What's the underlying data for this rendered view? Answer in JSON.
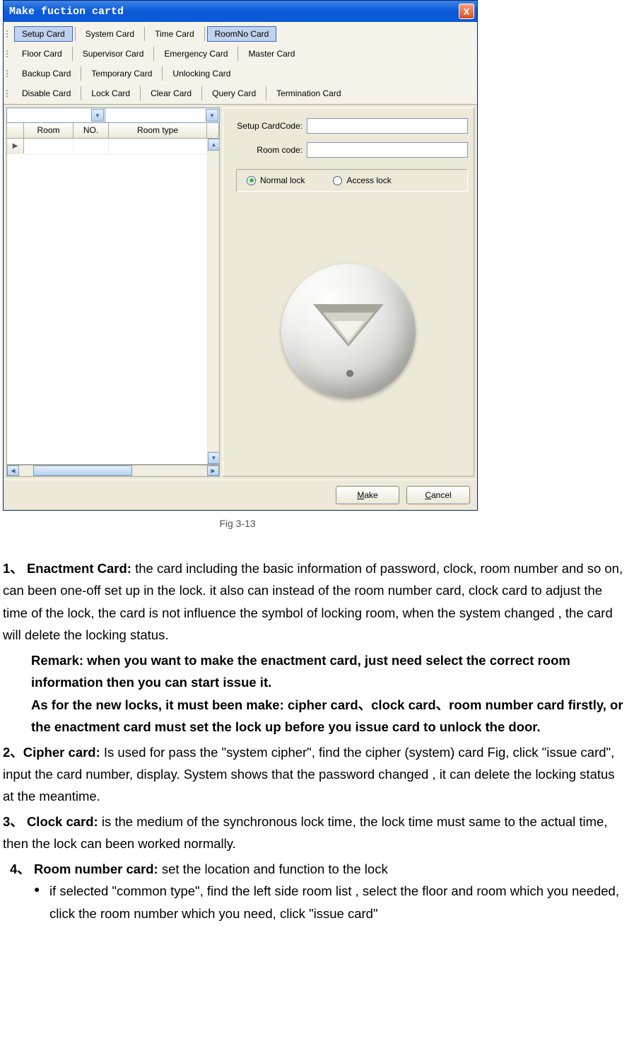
{
  "window": {
    "title": "Make fuction cartd",
    "close": "X"
  },
  "toolbar": {
    "row1": [
      "Setup Card",
      "System Card",
      "Time Card",
      "RoomNo Card"
    ],
    "row2": [
      "Floor Card",
      "Supervisor Card",
      "Emergency Card",
      "Master Card"
    ],
    "row3": [
      "Backup Card",
      "Temporary Card",
      "Unlocking Card"
    ],
    "row4": [
      "Disable Card",
      "Lock Card",
      "Clear Card",
      "Query Card",
      "Termination Card"
    ],
    "selected": [
      "Setup Card",
      "RoomNo Card"
    ]
  },
  "grid": {
    "headers": {
      "room": "Room",
      "no": "NO.",
      "type": "Room type"
    }
  },
  "form": {
    "setup_code_label": "Setup CardCode:",
    "room_code_label": "Room code:",
    "setup_code_value": "",
    "room_code_value": ""
  },
  "radios": {
    "normal": "Normal lock",
    "access": "Access lock",
    "selected": "normal"
  },
  "buttons": {
    "make": "Make",
    "make_accel": "M",
    "cancel": "Cancel",
    "cancel_accel": "C"
  },
  "caption": "Fig 3-13",
  "doc": {
    "item1_num": "1、",
    "item1_title": "Enactment Card: ",
    "item1_body": "the card including the basic information of password, clock, room number and so on, can been one-off set up in the lock. it also can instead of the room number card, clock card to adjust the time of the lock, the card is not influence the symbol of locking room, when the system changed , the card will delete the locking status.",
    "remark": "Remark: when you want to make the enactment card, just need select the correct room information then you can start issue it.",
    "asfor": "As for the new locks, it must been make: cipher card、clock card、room number card firstly, or the enactment card must set the lock up before you issue card to unlock the door.",
    "item2_num": "2、",
    "item2_title": "Cipher card: ",
    "item2_body": "Is used for pass the \"system cipher\", find the cipher (system) card Fig, click \"issue card\", input the card number, display. System shows that the password changed , it can delete the locking status at the meantime.",
    "item3_num": "3、",
    "item3_title": "Clock card: ",
    "item3_body": "is the medium of the synchronous lock time, the lock time must same to the actual time, then the lock can been worked normally.",
    "item4_num": "4、",
    "item4_title": "Room number card: ",
    "item4_body": "set the location and function to the lock",
    "item4_bullet": "if selected \"common type\", find the left side room list , select the floor and room which you needed, click the room number which you need, click \"issue card\""
  }
}
